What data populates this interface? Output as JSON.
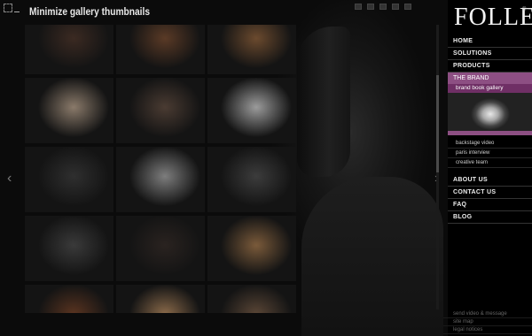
{
  "header": {
    "minimize_label": "Minimize gallery thumbnails"
  },
  "brand": {
    "logo": "FOLLEA",
    "reg": "®"
  },
  "nav": {
    "items_top": [
      "HOME",
      "SOLUTIONS",
      "PRODUCTS"
    ],
    "active": "THE BRAND",
    "active_sub": "brand book gallery",
    "sub_items": [
      "backstage video",
      "paris interview",
      "creative team"
    ],
    "items_bottom": [
      "ABOUT US",
      "CONTACT US",
      "FAQ",
      "BLOG"
    ]
  },
  "footer_links": [
    "send video & message",
    "site map",
    "legal notices"
  ],
  "thumbnails": [
    {
      "tone": "#3b2a22"
    },
    {
      "tone": "#5a3a26"
    },
    {
      "tone": "#6b4a2e"
    },
    {
      "tone": "#8a7a6a"
    },
    {
      "tone": "#4a3b32"
    },
    {
      "tone": "#9b9b9b"
    },
    {
      "tone": "#2f2f2f"
    },
    {
      "tone": "#7d7d7d"
    },
    {
      "tone": "#3c3c3c"
    },
    {
      "tone": "#3a3a3a"
    },
    {
      "tone": "#2a2320"
    },
    {
      "tone": "#7a5a3a"
    },
    {
      "tone": "#5a3420"
    },
    {
      "tone": "#8a6a4a"
    },
    {
      "tone": "#5a4636"
    }
  ],
  "colors": {
    "accent": "#8d4f83",
    "accent_dark": "#6f2f65",
    "background": "#0a0a0a"
  },
  "icons": [
    "fullscreen-icon",
    "minimize-icon",
    "left-arrow-icon",
    "right-arrow-icon"
  ]
}
